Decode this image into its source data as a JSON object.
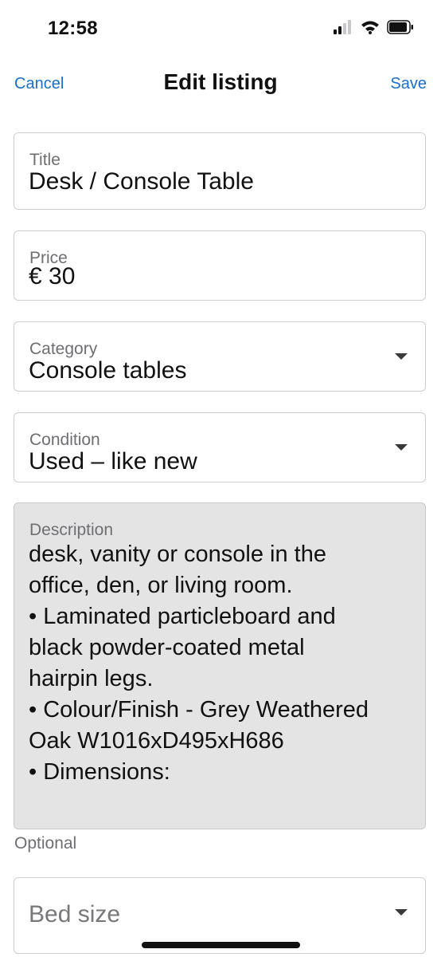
{
  "status_bar": {
    "time": "12:58"
  },
  "nav": {
    "cancel_label": "Cancel",
    "title": "Edit listing",
    "save_label": "Save",
    "accent_color": "#1a6fc7"
  },
  "form": {
    "title": {
      "label": "Title",
      "value": "Desk / Console Table"
    },
    "price": {
      "label": "Price",
      "value": "€ 30"
    },
    "category": {
      "label": "Category",
      "value": "Console tables"
    },
    "condition": {
      "label": "Condition",
      "value": "Used – like new"
    },
    "description": {
      "label": "Description",
      "lines": [
        "desk, vanity or console in the",
        "office, den, or living room.",
        "• Laminated particleboard and",
        "black powder-coated metal",
        "hairpin legs.",
        "• Colour/Finish - Grey Weathered",
        "Oak W1016xD495xH686",
        "• Dimensions:"
      ],
      "helper_text": "Optional"
    },
    "bed_size": {
      "placeholder": "Bed size"
    }
  },
  "icons": {
    "signal": "signal-bars-icon",
    "wifi": "wifi-icon",
    "battery": "battery-icon",
    "dropdown": "chevron-down-icon"
  }
}
